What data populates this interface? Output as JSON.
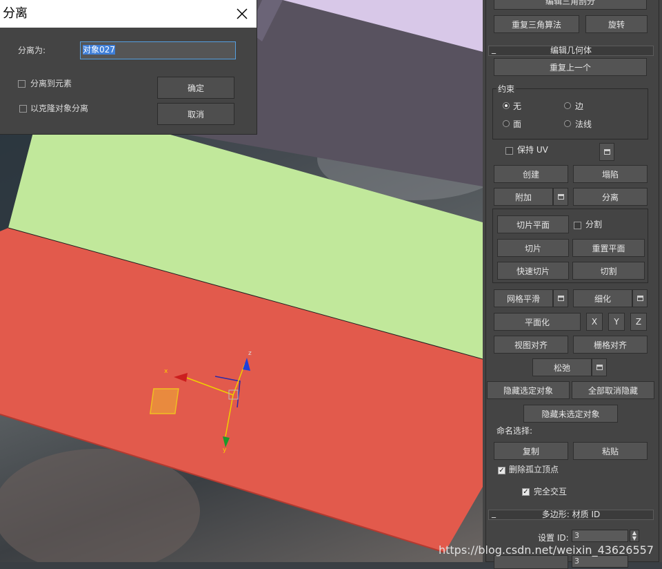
{
  "dialog": {
    "title": "分离",
    "name_label": "分离为:",
    "name_value": "对象027",
    "option_element": "分离到元素",
    "option_clone": "以克隆对象分离",
    "ok_label": "确定",
    "cancel_label": "取消"
  },
  "viewport": {
    "gizmo_axes": {
      "x": "x",
      "y": "y",
      "z": "z"
    },
    "colors": {
      "top_face": "#c1e89b",
      "front_face": "#e25a4c",
      "back_block": "#5a5462",
      "back_top": "#d8c8e8"
    }
  },
  "panel": {
    "top_partial_button": "编辑三角剖分",
    "retriangulate": "重复三角算法",
    "rotate": "旋转",
    "edit_geometry": {
      "header": "编辑几何体",
      "repeat_last": "重复上一个",
      "constraints_label": "约束",
      "constraints": [
        "无",
        "边",
        "面",
        "法线"
      ],
      "preserve_uv": "保持 UV",
      "create": "创建",
      "collapse": "塌陷",
      "attach": "附加",
      "detach": "分离",
      "slice_plane": "切片平面",
      "split": "分割",
      "slice": "切片",
      "reset_plane": "重置平面",
      "quickslice": "快速切片",
      "cut": "切割",
      "meshsmooth": "网格平滑",
      "tessellate": "细化",
      "make_planar": "平面化",
      "x": "X",
      "y": "Y",
      "z": "Z",
      "view_align": "视图对齐",
      "grid_align": "栅格对齐",
      "relax": "松弛",
      "hide_selected": "隐藏选定对象",
      "unhide_all": "全部取消隐藏",
      "hide_unselected": "隐藏未选定对象",
      "named_selections": "命名选择:",
      "copy": "复制",
      "paste": "粘贴",
      "delete_isolated": "删除孤立顶点",
      "full_interactivity": "完全交互"
    },
    "material_ids": {
      "header": "多边形: 材质 ID",
      "set_id_label": "设置 ID:",
      "set_id_value": "3",
      "select_id_value": "3"
    }
  },
  "watermark": "https://blog.csdn.net/weixin_43626557"
}
